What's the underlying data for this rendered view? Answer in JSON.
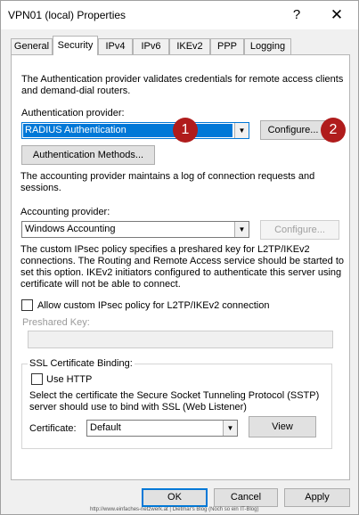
{
  "window": {
    "title": "VPN01 (local) Properties",
    "help_glyph": "?",
    "close_glyph": "✕"
  },
  "tabs": [
    {
      "label": "General",
      "active": false
    },
    {
      "label": "Security",
      "active": true
    },
    {
      "label": "IPv4",
      "active": false
    },
    {
      "label": "IPv6",
      "active": false
    },
    {
      "label": "IKEv2",
      "active": false
    },
    {
      "label": "PPP",
      "active": false
    },
    {
      "label": "Logging",
      "active": false
    }
  ],
  "security": {
    "auth_description_line1": "The Authentication provider validates credentials for remote access clients",
    "auth_description_line2": "and demand-dial routers.",
    "auth_provider_label": "Authentication provider:",
    "auth_provider_value": "RADIUS Authentication",
    "auth_configure_label": "Configure...",
    "auth_methods_label": "Authentication Methods...",
    "acct_description_line1": "The accounting provider maintains a log of connection requests and",
    "acct_description_line2": "sessions.",
    "acct_provider_label": "Accounting provider:",
    "acct_provider_value": "Windows Accounting",
    "acct_configure_label": "Configure...",
    "ipsec_description_line1": "The custom IPsec policy specifies a preshared key for L2TP/IKEv2",
    "ipsec_description_line2": "connections. The Routing and Remote Access service should be started to",
    "ipsec_description_line3": "set this option. IKEv2 initiators configured to authenticate this server using",
    "ipsec_description_line4": "certificate will not be able to connect.",
    "allow_ipsec_label": "Allow custom IPsec policy for L2TP/IKEv2 connection",
    "allow_ipsec_checked": false,
    "preshared_key_label": "Preshared Key:",
    "preshared_key_value": ""
  },
  "ssl_binding": {
    "group_label": "SSL Certificate Binding:",
    "use_http_label": "Use HTTP",
    "use_http_checked": false,
    "description_line1": "Select the certificate the Secure Socket Tunneling Protocol (SSTP)",
    "description_line2": "server should use to bind with SSL (Web Listener)",
    "certificate_label": "Certificate:",
    "certificate_value": "Default",
    "view_label": "View"
  },
  "footer": {
    "ok_label": "OK",
    "cancel_label": "Cancel",
    "apply_label": "Apply"
  },
  "annotations": {
    "badge1": "1",
    "badge2": "2",
    "badge_color": "#b01c1c"
  },
  "watermark": "http://www.einfaches-netzwerk.at | Dietmar's Blog (Noch so ein IT-Blog)"
}
